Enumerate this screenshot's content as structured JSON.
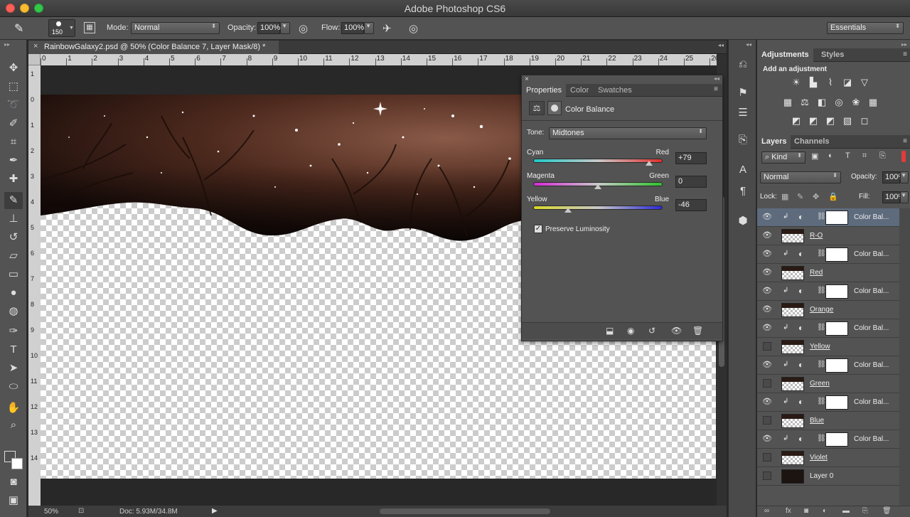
{
  "app": {
    "title": "Adobe Photoshop CS6"
  },
  "options": {
    "brush_size": "150",
    "mode_label": "Mode:",
    "mode_value": "Normal",
    "opacity_label": "Opacity:",
    "opacity_value": "100%",
    "flow_label": "Flow:",
    "flow_value": "100%",
    "workspace": "Essentials"
  },
  "document": {
    "tab_title": "RainbowGalaxy2.psd @ 50% (Color Balance 7, Layer Mask/8) *",
    "ruler_h": [
      "0",
      "1",
      "2",
      "3",
      "4",
      "5",
      "6",
      "7",
      "8",
      "9",
      "10",
      "11",
      "12",
      "13",
      "14",
      "15",
      "16",
      "17",
      "18",
      "19",
      "20",
      "21",
      "22",
      "23",
      "24",
      "25",
      "26"
    ],
    "ruler_v": [
      "1",
      "0",
      "1",
      "2",
      "3",
      "4",
      "5",
      "6",
      "7",
      "8",
      "9",
      "10",
      "11",
      "12",
      "13",
      "14"
    ]
  },
  "status": {
    "zoom": "50%",
    "doc": "Doc: 5.93M/34.8M"
  },
  "properties": {
    "tabs": [
      "Properties",
      "Color",
      "Swatches"
    ],
    "panel_title": "Color Balance",
    "tone_label": "Tone:",
    "tone_value": "Midtones",
    "sliders": [
      {
        "left": "Cyan",
        "right": "Red",
        "value": "+79",
        "level": 79
      },
      {
        "left": "Magenta",
        "right": "Green",
        "value": "0",
        "level": 0
      },
      {
        "left": "Yellow",
        "right": "Blue",
        "value": "-46",
        "level": -46
      }
    ],
    "preserve_label": "Preserve Luminosity",
    "preserve_checked": true
  },
  "adjustments": {
    "tabs": [
      "Adjustments",
      "Styles"
    ],
    "heading": "Add an adjustment"
  },
  "layers": {
    "tabs": [
      "Layers",
      "Channels"
    ],
    "filter_kind": "Kind",
    "blend_mode": "Normal",
    "opacity_label": "Opacity:",
    "opacity_value": "100%",
    "lock_label": "Lock:",
    "fill_label": "Fill:",
    "fill_value": "100%",
    "items": [
      {
        "name": "Color Bal...",
        "kind": "adjustment",
        "visible": true,
        "selected": true
      },
      {
        "name": "R-O",
        "kind": "pixel",
        "visible": true
      },
      {
        "name": "Color Bal...",
        "kind": "adjustment",
        "visible": true
      },
      {
        "name": "Red",
        "kind": "pixel",
        "visible": true
      },
      {
        "name": "Color Bal...",
        "kind": "adjustment",
        "visible": true
      },
      {
        "name": "Orange",
        "kind": "pixel",
        "visible": true
      },
      {
        "name": "Color Bal...",
        "kind": "adjustment",
        "visible": true
      },
      {
        "name": "Yellow",
        "kind": "pixel",
        "visible": false
      },
      {
        "name": "Color Bal...",
        "kind": "adjustment",
        "visible": true
      },
      {
        "name": "Green",
        "kind": "pixel",
        "visible": false
      },
      {
        "name": "Color Bal...",
        "kind": "adjustment",
        "visible": true
      },
      {
        "name": "Blue",
        "kind": "pixel",
        "visible": false
      },
      {
        "name": "Color Bal...",
        "kind": "adjustment",
        "visible": true
      },
      {
        "name": "Violet",
        "kind": "pixel",
        "visible": false
      },
      {
        "name": "Layer 0",
        "kind": "dark",
        "visible": false
      }
    ]
  }
}
